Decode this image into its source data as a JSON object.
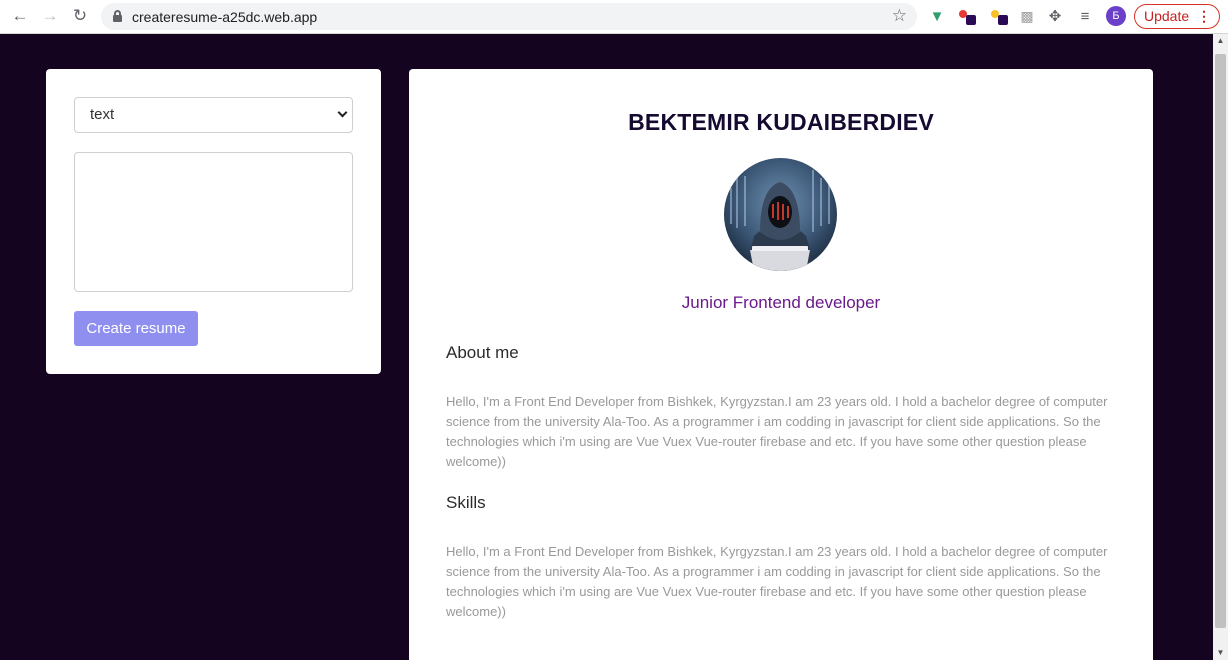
{
  "browser": {
    "url": "createresume-a25dc.web.app",
    "update_label": "Update",
    "profile_initial": "Б",
    "menu_glyph": "⋮"
  },
  "form": {
    "select_value": "text",
    "textarea_value": "",
    "create_button_label": "Create resume"
  },
  "resume": {
    "name": "BEKTEMIR KUDAIBERDIEV",
    "job_title": "Junior Frontend developer",
    "about_heading": "About me",
    "about_text": "Hello, I'm a Front End Developer from Bishkek, Kyrgyzstan.I am 23 years old. I hold a bachelor degree of computer science from the university Ala-Too. As a programmer i am codding in javascript for client side applications. So the technologies which i'm using are Vue Vuex Vue-router firebase and etc. If you have some other question please welcome))",
    "skills_heading": "Skills",
    "skills_text": "Hello, I'm a Front End Developer from Bishkek, Kyrgyzstan.I am 23 years old. I hold a bachelor degree of computer science from the university Ala-Too. As a programmer i am codding in javascript for client side applications. So the technologies which i'm using are Vue Vuex Vue-router firebase and etc. If you have some other question please welcome))"
  },
  "colors": {
    "page_background": "#14041f",
    "create_button": "#8f8ff0",
    "job_title": "#6a1a8a",
    "name": "#160a30"
  }
}
